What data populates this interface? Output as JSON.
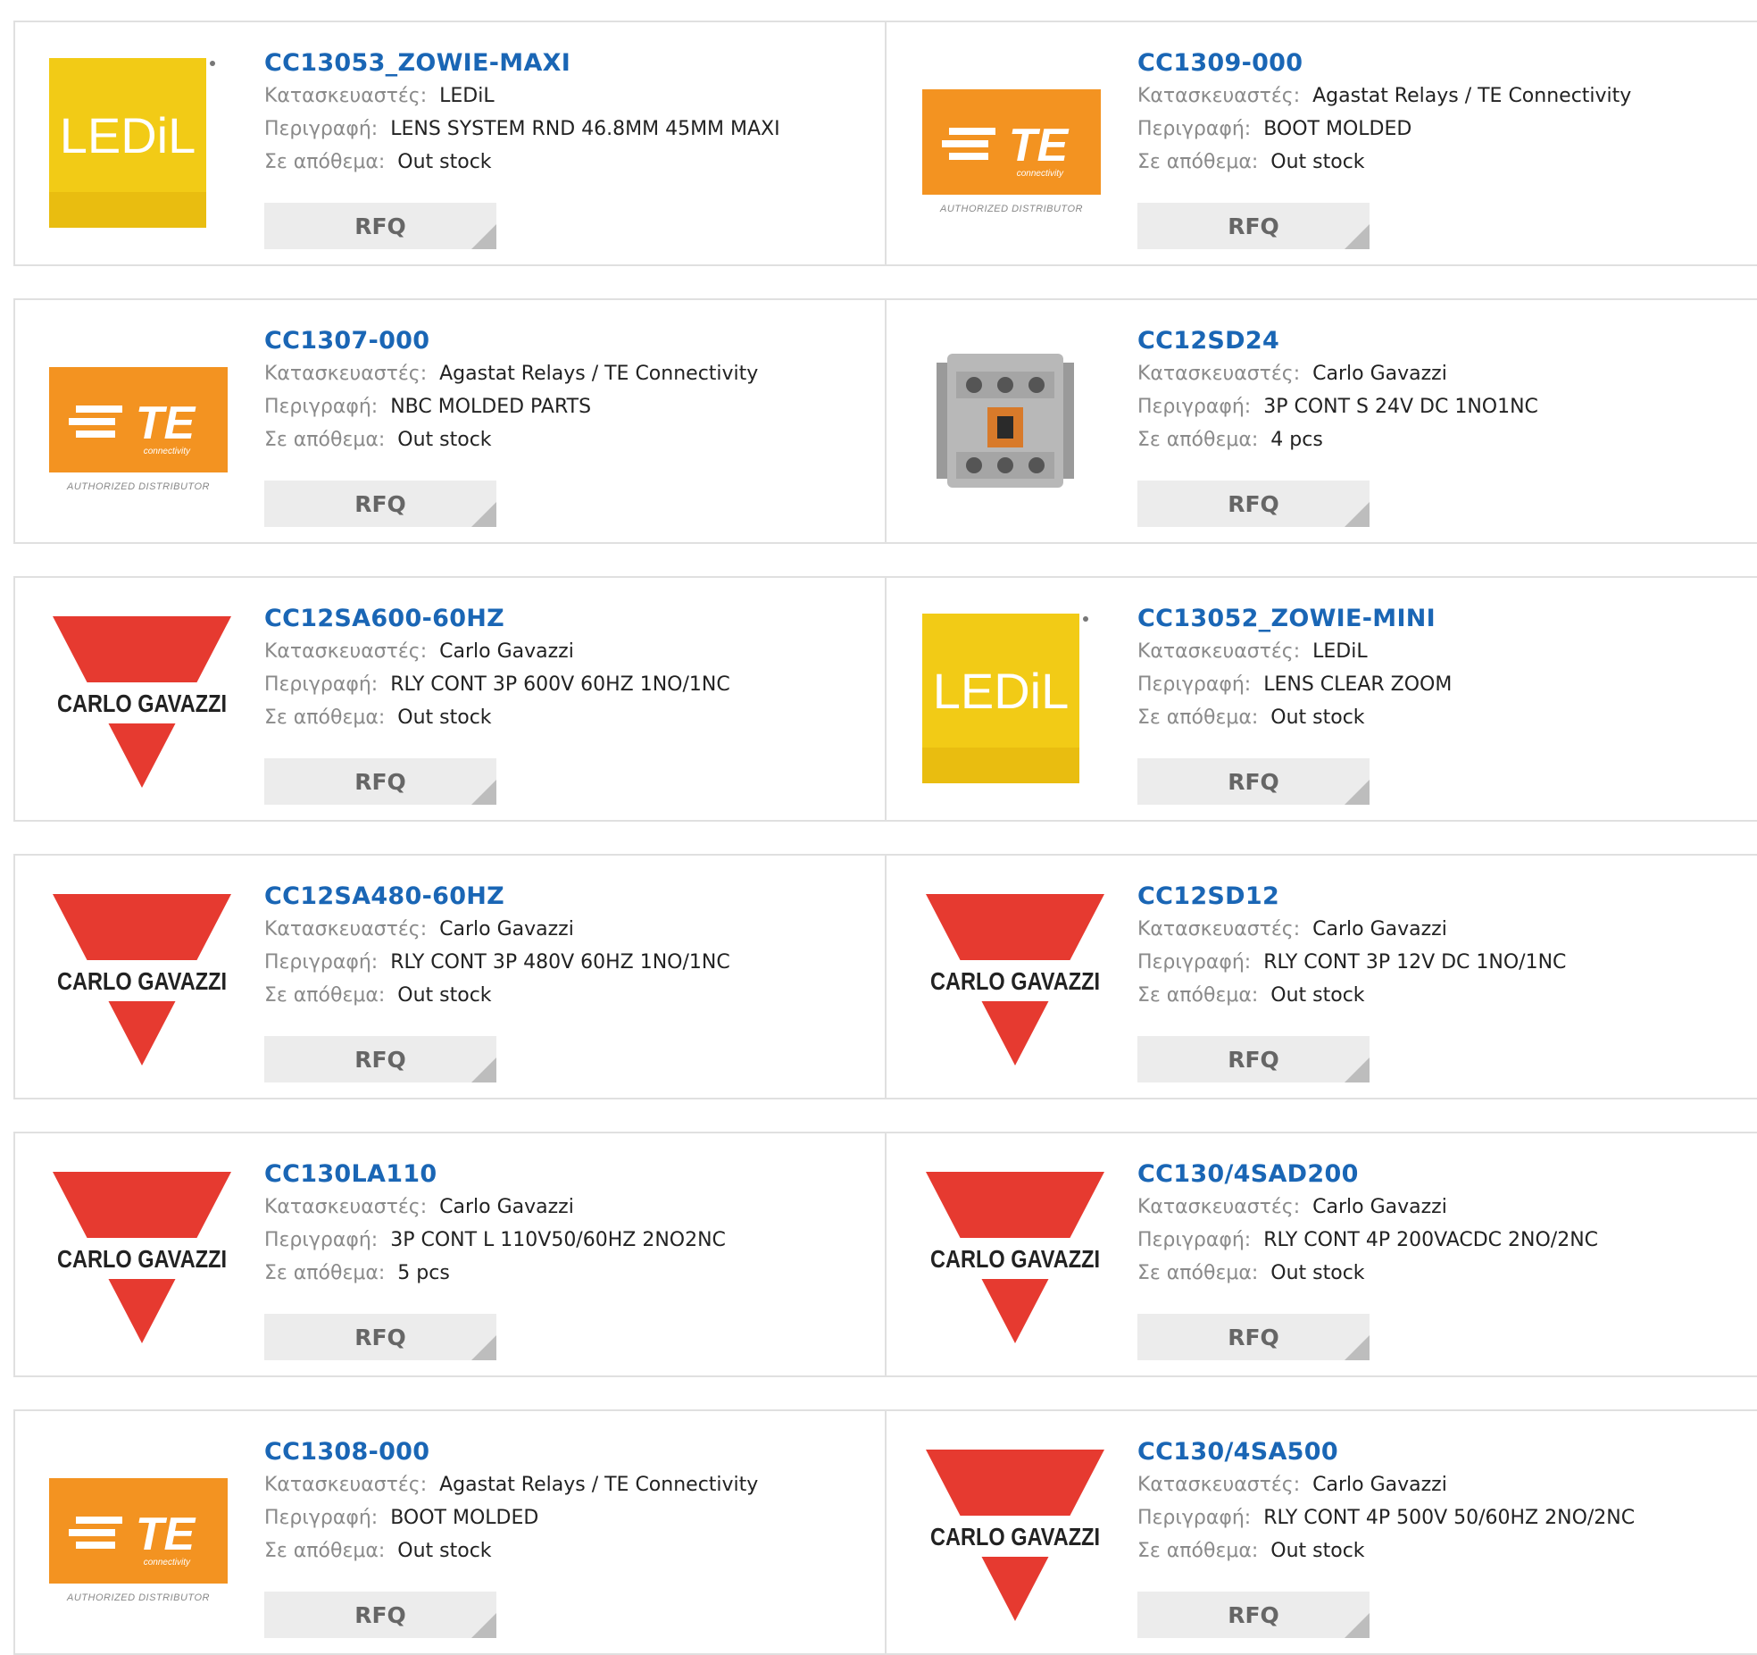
{
  "labels": {
    "manufacturer": "Κατασκευαστές:",
    "description": "Περιγραφή:",
    "stock": "Σε απόθεμα:",
    "rfq": "RFQ"
  },
  "logo_text": {
    "ledil": "LEDiL",
    "te": "TE",
    "te_sub": "connectivity",
    "te_authorized": "AUTHORIZED DISTRIBUTOR",
    "carlo": "CARLO GAVAZZI"
  },
  "colors": {
    "link": "#1a66b5",
    "label": "#8a8a8a",
    "ledil_yellow": "#f2cb16",
    "te_orange": "#f39321",
    "carlo_red": "#e63a30"
  },
  "products": [
    {
      "part": "CC13053_ZOWIE-MAXI",
      "logo": "ledil",
      "manufacturer": "LEDiL",
      "description": "LENS SYSTEM RND 46.8MM 45MM MAXI",
      "stock": "Out stock"
    },
    {
      "part": "CC1309-000",
      "logo": "te",
      "manufacturer": "Agastat Relays / TE Connectivity",
      "description": "BOOT MOLDED",
      "stock": "Out stock"
    },
    {
      "part": "CC1307-000",
      "logo": "te",
      "manufacturer": "Agastat Relays / TE Connectivity",
      "description": "NBC MOLDED PARTS",
      "stock": "Out stock"
    },
    {
      "part": "CC12SD24",
      "logo": "contactor",
      "manufacturer": "Carlo Gavazzi",
      "description": "3P CONT S 24V DC 1NO1NC",
      "stock": "4 pcs"
    },
    {
      "part": "CC12SA600-60HZ",
      "logo": "carlo",
      "manufacturer": "Carlo Gavazzi",
      "description": "RLY CONT 3P 600V 60HZ 1NO/1NC",
      "stock": "Out stock"
    },
    {
      "part": "CC13052_ZOWIE-MINI",
      "logo": "ledil",
      "manufacturer": "LEDiL",
      "description": "LENS CLEAR ZOOM",
      "stock": "Out stock"
    },
    {
      "part": "CC12SA480-60HZ",
      "logo": "carlo",
      "manufacturer": "Carlo Gavazzi",
      "description": "RLY CONT 3P 480V 60HZ 1NO/1NC",
      "stock": "Out stock"
    },
    {
      "part": "CC12SD12",
      "logo": "carlo",
      "manufacturer": "Carlo Gavazzi",
      "description": "RLY CONT 3P 12V DC 1NO/1NC",
      "stock": "Out stock"
    },
    {
      "part": "CC130LA110",
      "logo": "carlo",
      "manufacturer": "Carlo Gavazzi",
      "description": "3P CONT L 110V50/60HZ 2NO2NC",
      "stock": "5 pcs"
    },
    {
      "part": "CC130/4SAD200",
      "logo": "carlo",
      "manufacturer": "Carlo Gavazzi",
      "description": "RLY CONT 4P 200VACDC 2NO/2NC",
      "stock": "Out stock"
    },
    {
      "part": "CC1308-000",
      "logo": "te",
      "manufacturer": "Agastat Relays / TE Connectivity",
      "description": "BOOT MOLDED",
      "stock": "Out stock"
    },
    {
      "part": "CC130/4SA500",
      "logo": "carlo",
      "manufacturer": "Carlo Gavazzi",
      "description": "RLY CONT 4P 500V 50/60HZ 2NO/2NC",
      "stock": "Out stock"
    }
  ]
}
